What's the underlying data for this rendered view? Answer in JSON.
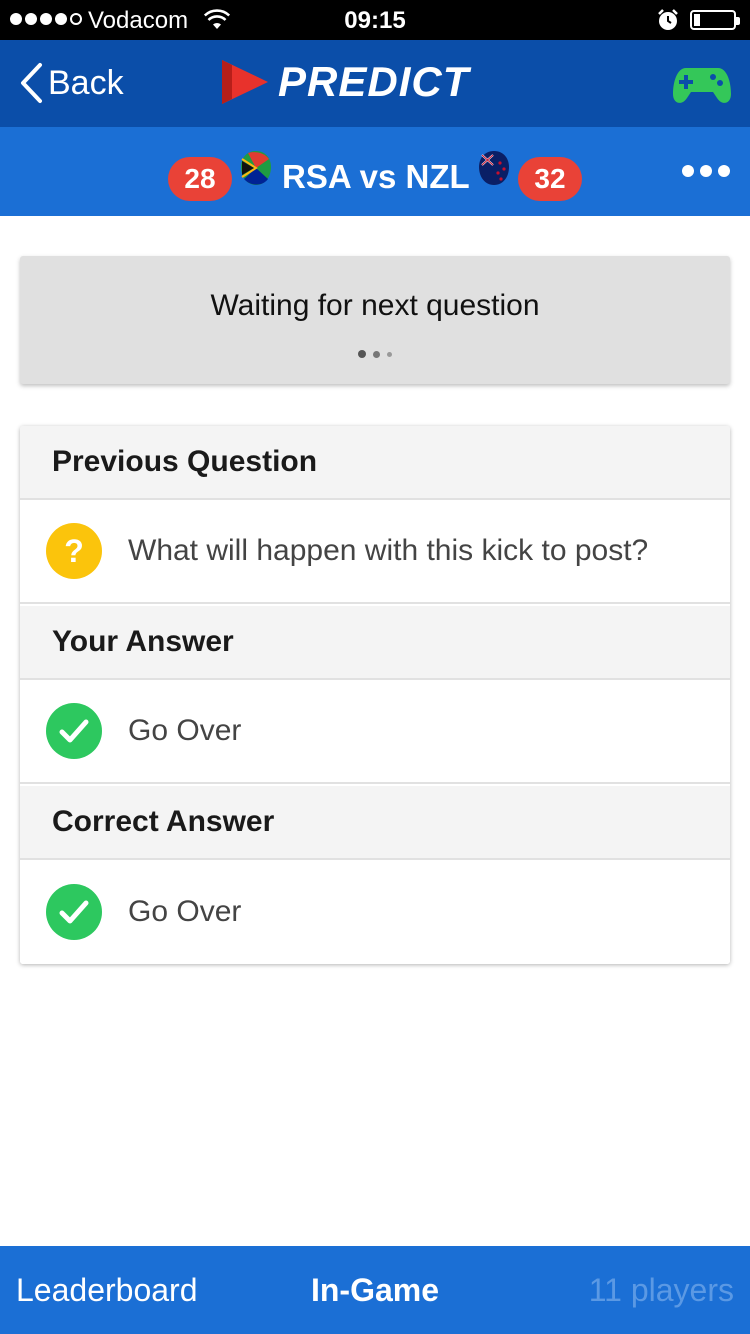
{
  "status_bar": {
    "carrier": "Vodacom",
    "time": "09:15",
    "signal_bars_filled": 4,
    "signal_bars_total": 5,
    "battery_level": 0.1
  },
  "nav": {
    "back_label": "Back",
    "app_title": "PREDICT",
    "colors": {
      "background": "#0b4ea9",
      "logo_red": "#e8322c",
      "gamepad_green": "#34c759"
    }
  },
  "match": {
    "home_score": "28",
    "title": "RSA vs NZL",
    "away_score": "32",
    "colors": {
      "background": "#1b6fd5",
      "badge": "#e94237"
    }
  },
  "waiting": {
    "text": "Waiting for next question"
  },
  "question_card": {
    "previous_question_header": "Previous Question",
    "question_text": "What will happen with this kick to post?",
    "your_answer_header": "Your Answer",
    "your_answer": "Go Over",
    "correct_answer_header": "Correct Answer",
    "correct_answer": "Go Over",
    "colors": {
      "question_icon": "#fbc40c",
      "check_icon": "#2dc85f"
    }
  },
  "tabs": {
    "leaderboard": "Leaderboard",
    "in_game": "In-Game",
    "players": "11 players"
  }
}
